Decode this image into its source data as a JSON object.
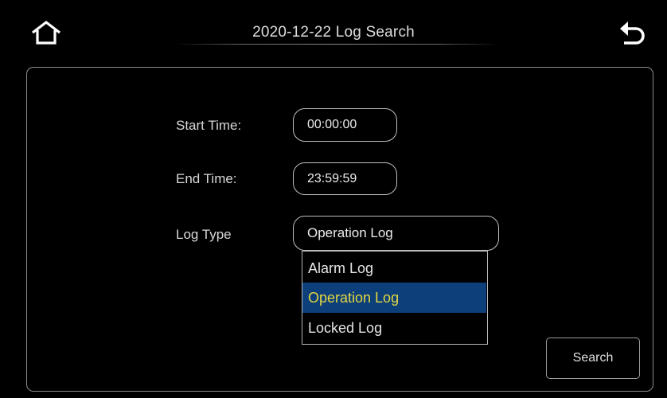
{
  "header": {
    "title": "2020-12-22 Log Search",
    "home_icon": "home-icon",
    "back_icon": "back-arrow-icon"
  },
  "form": {
    "start_time": {
      "label": "Start Time:",
      "value": "00:00:00"
    },
    "end_time": {
      "label": "End Time:",
      "value": "23:59:59"
    },
    "log_type": {
      "label": "Log Type",
      "selected": "Operation Log",
      "options": [
        "Alarm Log",
        "Operation Log",
        "Locked Log"
      ]
    },
    "search_label": "Search"
  },
  "colors": {
    "background": "#000000",
    "highlight_bg": "#0d3f7a",
    "highlight_text": "#e3d63f",
    "border": "#8c8c8c"
  }
}
